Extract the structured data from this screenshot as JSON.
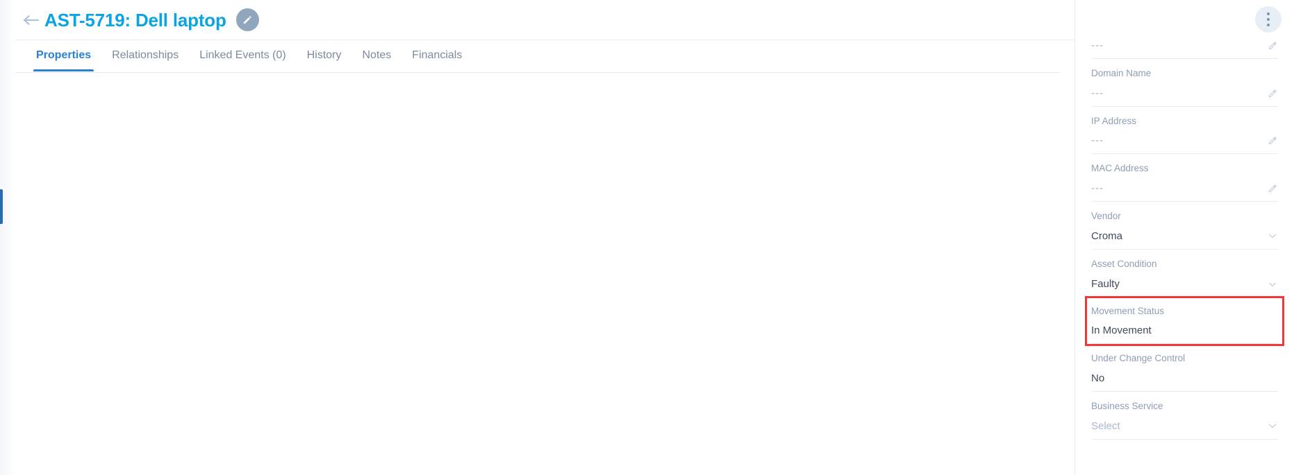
{
  "header": {
    "back_icon": "arrow-left-icon",
    "title": "AST-5719: Dell laptop",
    "edit_icon": "pencil-icon",
    "more_icon": "kebab-menu-icon"
  },
  "tabs": [
    {
      "label": "Properties",
      "active": true
    },
    {
      "label": "Relationships",
      "active": false
    },
    {
      "label": "Linked Events (0)",
      "active": false
    },
    {
      "label": "History",
      "active": false
    },
    {
      "label": "Notes",
      "active": false
    },
    {
      "label": "Financials",
      "active": false
    }
  ],
  "properties_panel": {
    "fields": [
      {
        "label": "",
        "value": "---",
        "control": "pencil",
        "muted": true,
        "highlight": false,
        "partial": true
      },
      {
        "label": "Domain Name",
        "value": "---",
        "control": "pencil",
        "muted": true,
        "highlight": false
      },
      {
        "label": "IP Address",
        "value": "---",
        "control": "pencil",
        "muted": true,
        "highlight": false
      },
      {
        "label": "MAC Address",
        "value": "---",
        "control": "pencil",
        "muted": true,
        "highlight": false
      },
      {
        "label": "Vendor",
        "value": "Croma",
        "control": "chevron",
        "muted": false,
        "highlight": false
      },
      {
        "label": "Asset Condition",
        "value": "Faulty",
        "control": "chevron",
        "muted": false,
        "highlight": false
      },
      {
        "label": "Movement Status",
        "value": "In Movement",
        "control": "none",
        "muted": false,
        "highlight": true
      },
      {
        "label": "Under Change Control",
        "value": "No",
        "control": "none",
        "muted": false,
        "highlight": false
      },
      {
        "label": "Business Service",
        "value": "Select",
        "control": "chevron",
        "placeholder": true,
        "highlight": false
      }
    ]
  },
  "colors": {
    "title_blue": "#0aa3e3",
    "tab_active_blue": "#2b7fd4",
    "highlight_red": "#f0373a",
    "label_grey": "#8d9eb4",
    "rail_blue": "#2b6cb0"
  }
}
